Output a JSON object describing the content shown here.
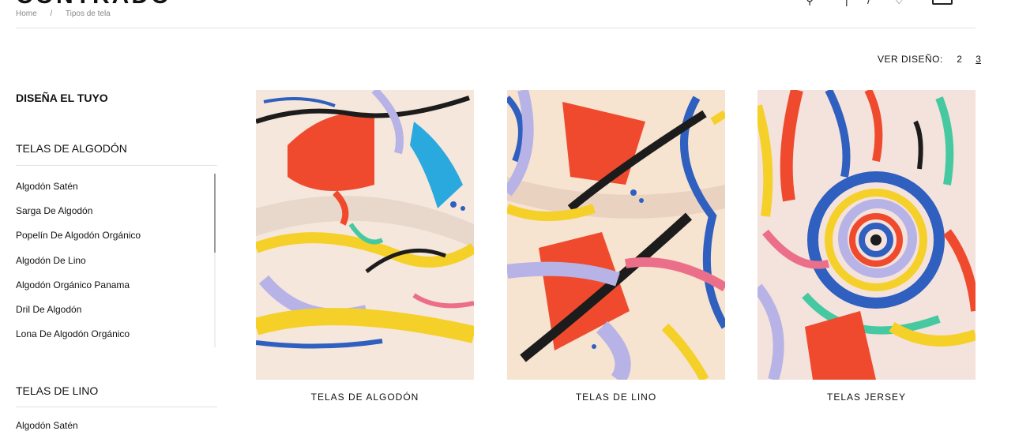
{
  "header": {
    "logo": "CONTRADO",
    "breadcrumb": [
      "Home",
      "/",
      "Tipos de tela"
    ]
  },
  "view": {
    "label": "VER DISEÑO:",
    "options": [
      "2",
      "3"
    ],
    "active": "3"
  },
  "sidebar": {
    "design_title": "DISEÑA EL TUYO",
    "cotton_title": "TELAS DE ALGODÓN",
    "cotton_items": [
      "Algodón Satén",
      "Sarga De Algodón",
      "Popelín De Algodón Orgánico",
      "Algodón De Lino",
      "Algodón Orgánico Panama",
      "Dril De Algodón",
      "Lona De Algodón Orgánico"
    ],
    "linen_title": "TELAS DE LINO",
    "linen_first_item": "Algodón Satén"
  },
  "products": [
    {
      "title": "TELAS DE ALGODÓN"
    },
    {
      "title": "TELAS DE LINO"
    },
    {
      "title": "TELAS JERSEY"
    }
  ],
  "colors": {
    "fabric_bg": "#f6e7dc",
    "red": "#ef4a2d",
    "yellow": "#f5d028",
    "blue": "#2f5fbf",
    "lilac": "#b7b3e6",
    "pink": "#ec6f8a",
    "cyan": "#2aa9df",
    "black": "#1c1c1c",
    "green": "#46c9a0"
  }
}
